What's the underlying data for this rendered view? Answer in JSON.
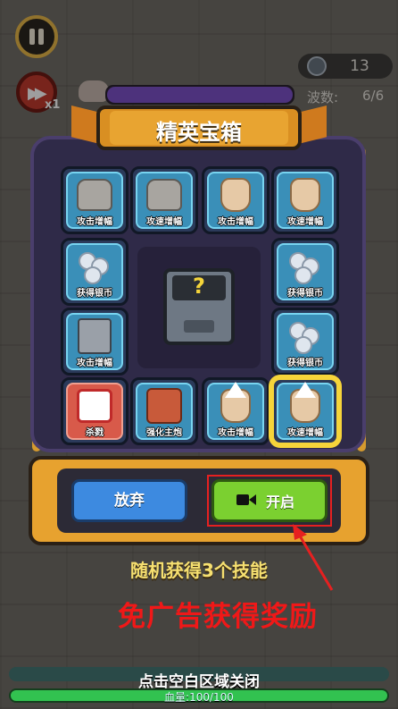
{
  "hud": {
    "speed_multiplier": "x1",
    "coin_count": "13",
    "wave_label": "波数:",
    "wave_value": "6/6",
    "wave_progress": 1.0
  },
  "modal": {
    "title": "精英宝箱",
    "skills": [
      {
        "label": "攻击增幅",
        "icon": "gauntlet-icon"
      },
      {
        "label": "攻速增幅",
        "icon": "gauntlet-icon"
      },
      {
        "label": "攻击增幅",
        "icon": "scroll-sack-icon"
      },
      {
        "label": "攻速增幅",
        "icon": "scroll-sack-icon"
      },
      {
        "label": "获得银币",
        "icon": "silver-coins-icon"
      },
      {
        "label": "获得银币",
        "icon": "silver-coins-icon"
      },
      {
        "label": "攻击增幅",
        "icon": "spikes-icon"
      },
      {
        "label": "获得银币",
        "icon": "silver-coins-icon"
      },
      {
        "label": "杀戮",
        "icon": "slash-icon"
      },
      {
        "label": "强化主炮",
        "icon": "cannon-icon"
      },
      {
        "label": "攻击增幅",
        "icon": "arrow-up-sack-icon"
      },
      {
        "label": "攻速增幅",
        "icon": "arrow-up-sack-icon"
      }
    ],
    "chest_symbol": "?",
    "give_up_label": "放弃",
    "open_label": "开启",
    "skills_note": "随机获得3个技能"
  },
  "annotation": "免广告获得奖励",
  "footer": {
    "hint": "点击空白区域关闭",
    "hp_label": "血量:100/100",
    "hp_fraction": 1.0
  },
  "colors": {
    "accent_orange": "#e7a22f",
    "open_green": "#7bd030",
    "give_up_blue": "#3d8ae0",
    "annotation_red": "#f01818",
    "selected_gold": "#f6d43a"
  }
}
